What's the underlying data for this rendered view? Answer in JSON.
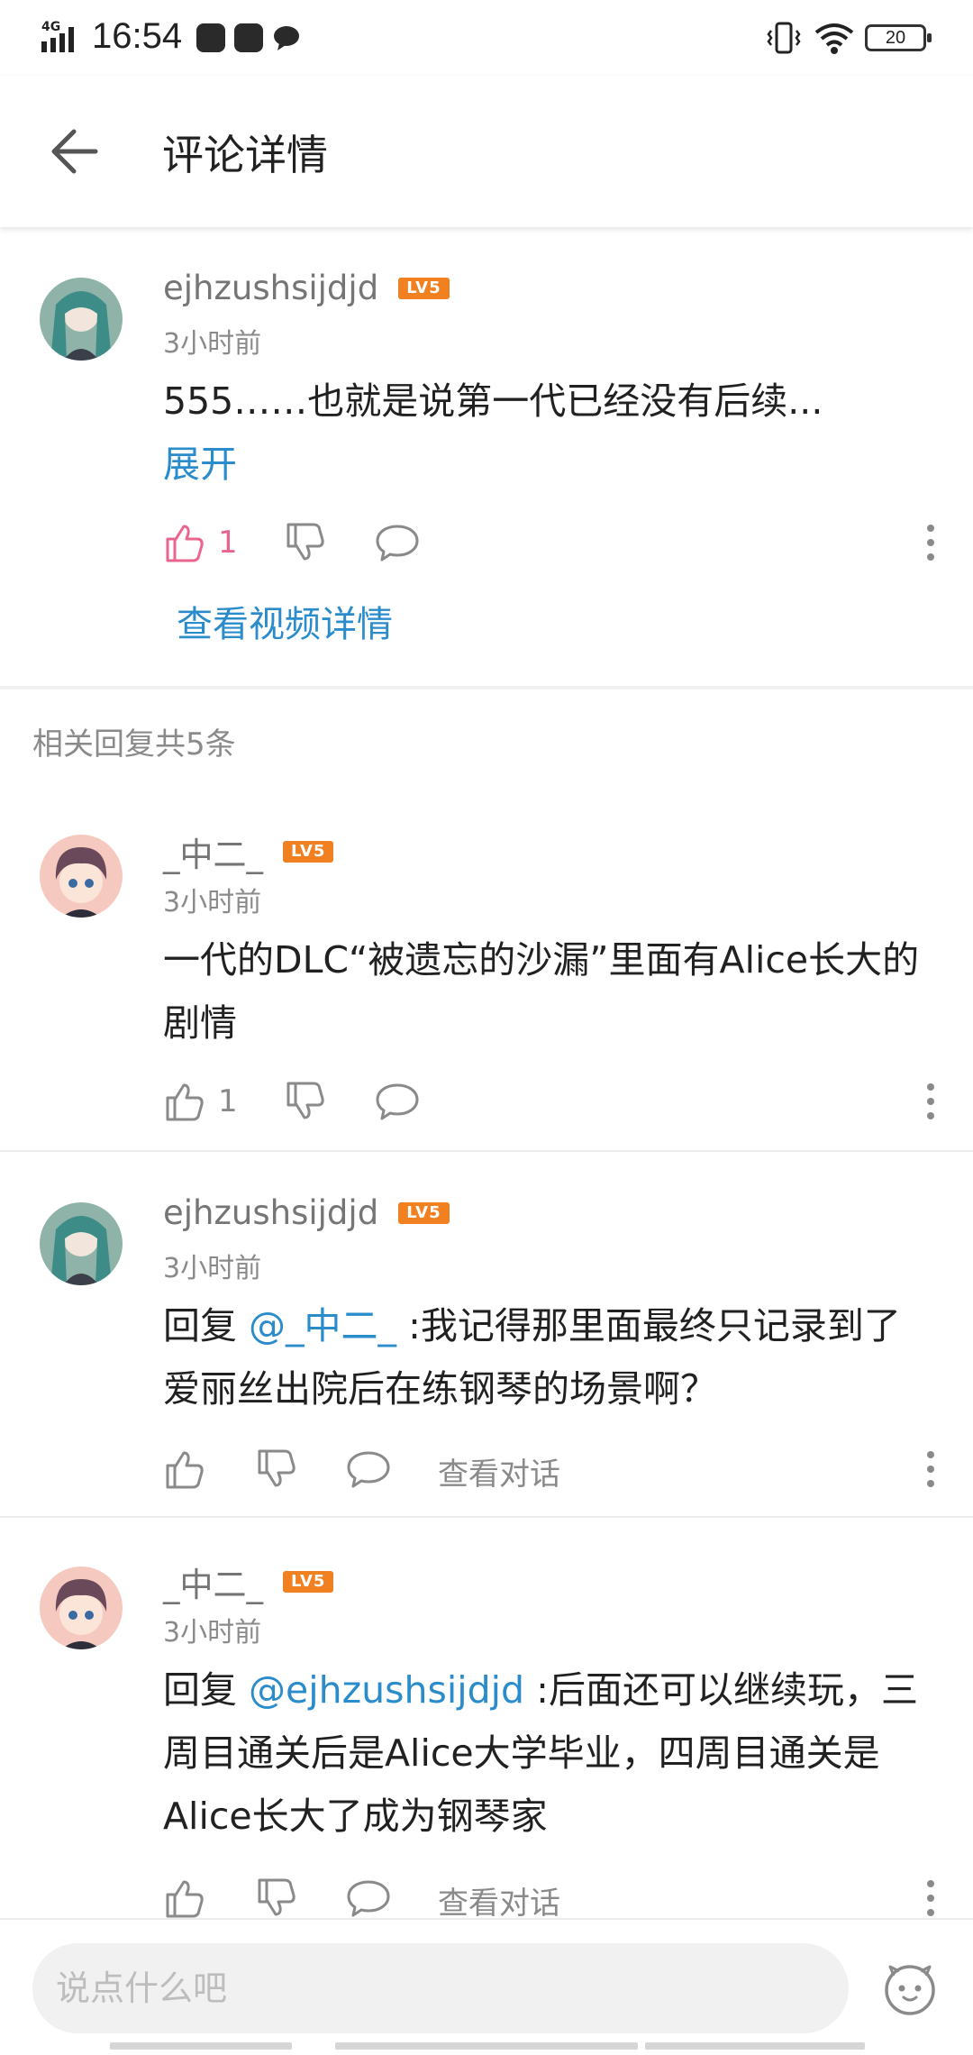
{
  "status_bar": {
    "network": "4G",
    "time": "16:54",
    "battery": "20"
  },
  "app_bar": {
    "title": "评论详情"
  },
  "main_comment": {
    "username": "ejhzushsijdjd",
    "level": "LV5",
    "time": "3小时前",
    "text": "555……也就是说第一代已经没有后续...",
    "expand_label": "展开",
    "like_count": "1",
    "view_video_label": "查看视频详情"
  },
  "replies_header": "相关回复共5条",
  "replies": [
    {
      "username": "_中二_",
      "level": "LV5",
      "time": "3小时前",
      "text": "一代的DLC“被遗忘的沙漏”里面有Alice长大的剧情",
      "like_count": "1"
    },
    {
      "username": "ejhzushsijdjd",
      "level": "LV5",
      "time": "3小时前",
      "reply_prefix": "回复 ",
      "mention": "@_中二_",
      "text": " :我记得那里面最终只记录到了爱丽丝出院后在练钢琴的场景啊？",
      "view_chat_label": "查看对话"
    },
    {
      "username": "_中二_",
      "level": "LV5",
      "time": "3小时前",
      "reply_prefix": "回复 ",
      "mention": "@ejhzushsijdjd",
      "text": " :后面还可以继续玩，三周目通关后是Alice大学毕业，四周目通关是Alice长大了成为钢琴家",
      "view_chat_label": "查看对话"
    }
  ],
  "bottom_bar": {
    "input_placeholder": "说点什么吧"
  },
  "colors": {
    "link": "#2b8ccc",
    "liked": "#e8668e",
    "level_badge": "#f08020"
  }
}
